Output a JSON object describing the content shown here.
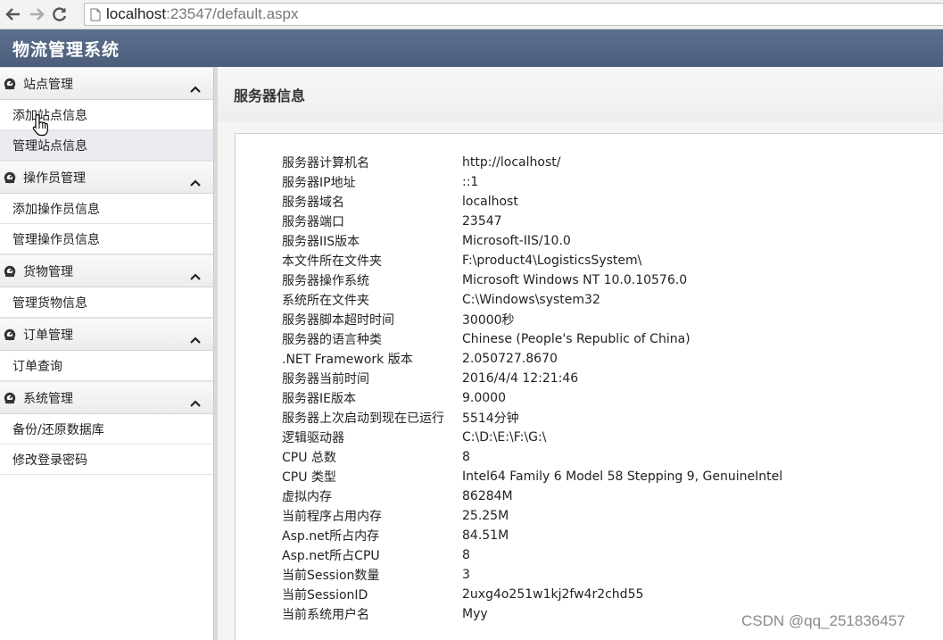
{
  "browser": {
    "url_host": "localhost",
    "url_rest": ":23547/default.aspx",
    "icons": [
      "back-arrow-icon",
      "forward-arrow-icon",
      "reload-icon",
      "page-icon"
    ]
  },
  "app": {
    "title": "物流管理系统"
  },
  "sidebar": {
    "groups": [
      {
        "label": "站点管理",
        "items": [
          "添加站点信息",
          "管理站点信息"
        ]
      },
      {
        "label": "操作员管理",
        "items": [
          "添加操作员信息",
          "管理操作员信息"
        ]
      },
      {
        "label": "货物管理",
        "items": [
          "管理货物信息"
        ]
      },
      {
        "label": "订单管理",
        "items": [
          "订单查询"
        ]
      },
      {
        "label": "系统管理",
        "items": [
          "备份/还原数据库",
          "修改登录密码"
        ]
      }
    ]
  },
  "main": {
    "title": "服务器信息",
    "rows": [
      {
        "k": "服务器计算机名",
        "v": "http://localhost/"
      },
      {
        "k": "服务器IP地址",
        "v": "::1"
      },
      {
        "k": "服务器域名",
        "v": "localhost"
      },
      {
        "k": "服务器端口",
        "v": "23547"
      },
      {
        "k": "服务器IIS版本",
        "v": "Microsoft-IIS/10.0"
      },
      {
        "k": "本文件所在文件夹",
        "v": "F:\\product4\\LogisticsSystem\\"
      },
      {
        "k": "服务器操作系统",
        "v": "Microsoft Windows NT 10.0.10576.0"
      },
      {
        "k": "系统所在文件夹",
        "v": "C:\\Windows\\system32"
      },
      {
        "k": "服务器脚本超时时间",
        "v": "30000秒"
      },
      {
        "k": "服务器的语言种类",
        "v": "Chinese (People's Republic of China)"
      },
      {
        "k": ".NET Framework 版本",
        "v": "2.050727.8670"
      },
      {
        "k": "服务器当前时间",
        "v": "2016/4/4 12:21:46"
      },
      {
        "k": "服务器IE版本",
        "v": "9.0000"
      },
      {
        "k": "服务器上次启动到现在已运行",
        "v": "5514分钟"
      },
      {
        "k": "逻辑驱动器",
        "v": "C:\\D:\\E:\\F:\\G:\\"
      },
      {
        "k": "CPU 总数",
        "v": "8"
      },
      {
        "k": "CPU 类型",
        "v": "Intel64 Family 6 Model 58 Stepping 9, GenuineIntel"
      },
      {
        "k": "虚拟内存",
        "v": "86284M"
      },
      {
        "k": "当前程序占用内存",
        "v": "25.25M"
      },
      {
        "k": "Asp.net所占内存",
        "v": "84.51M"
      },
      {
        "k": "Asp.net所占CPU",
        "v": "8"
      },
      {
        "k": "当前Session数量",
        "v": "3"
      },
      {
        "k": "当前SessionID",
        "v": "2uxg4o251w1kj2fw4r2chd55"
      },
      {
        "k": "当前系统用户名",
        "v": "Myy"
      }
    ]
  },
  "watermark": "CSDN @qq_251836457",
  "colors": {
    "header_bg": "#4f6180",
    "active_item_bg": "#ecebf2"
  }
}
